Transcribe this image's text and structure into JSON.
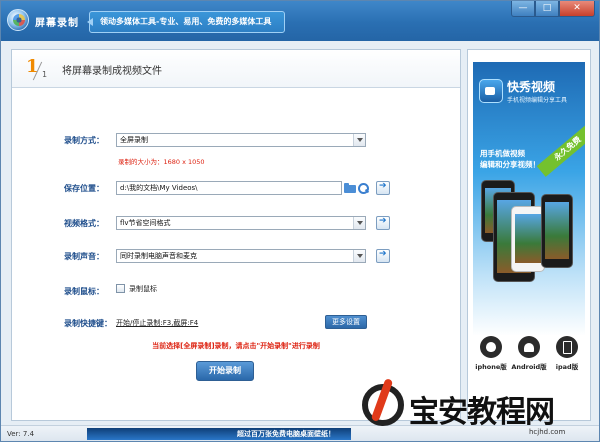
{
  "window": {
    "title": "屏幕录制",
    "slogan": "领动多媒体工具-专业、易用、免费的多媒体工具",
    "controls": {
      "min": "—",
      "max": "□",
      "close": "✕"
    }
  },
  "step": {
    "number": "1",
    "total": "1",
    "title": "将屏幕录制成视频文件"
  },
  "form": {
    "mode_label": "录制方式：",
    "mode_value": "全屏录制",
    "size_hint": "录制的大小为：1680 x 1050",
    "save_label": "保存位置：",
    "save_path": "d:\\我的文档\\My Videos\\",
    "format_label": "视频格式：",
    "format_value": "flv节省空间格式",
    "audio_label": "录制声音：",
    "audio_value": "同时录制电脑声音和麦克",
    "mouse_label": "录制鼠标：",
    "mouse_checkbox_label": "录制鼠标",
    "hotkey_label": "录制快捷键：",
    "hotkey_value": "开始/停止录制:F3,截屏:F4",
    "more_button": "更多设置",
    "notice": "当前选择[全屏录制]录制，请点击\"开始录制\"进行录制",
    "start_button": "开始录制"
  },
  "ad": {
    "title": "快秀视频",
    "subtitle": "手机视频编辑分享工具",
    "ribbon": "永久免费",
    "slogan_line1": "用手机做视频",
    "slogan_line2": "编辑和分享视频！",
    "platforms": [
      {
        "label": "iphone版"
      },
      {
        "label": "Android版"
      },
      {
        "label": "ipad版"
      }
    ]
  },
  "status": {
    "version": "Ver: 7.4",
    "banner": "超过百万张免费电脑桌面壁纸！"
  },
  "watermark": {
    "text": "宝安教程网",
    "url": "hcjhd.com"
  }
}
